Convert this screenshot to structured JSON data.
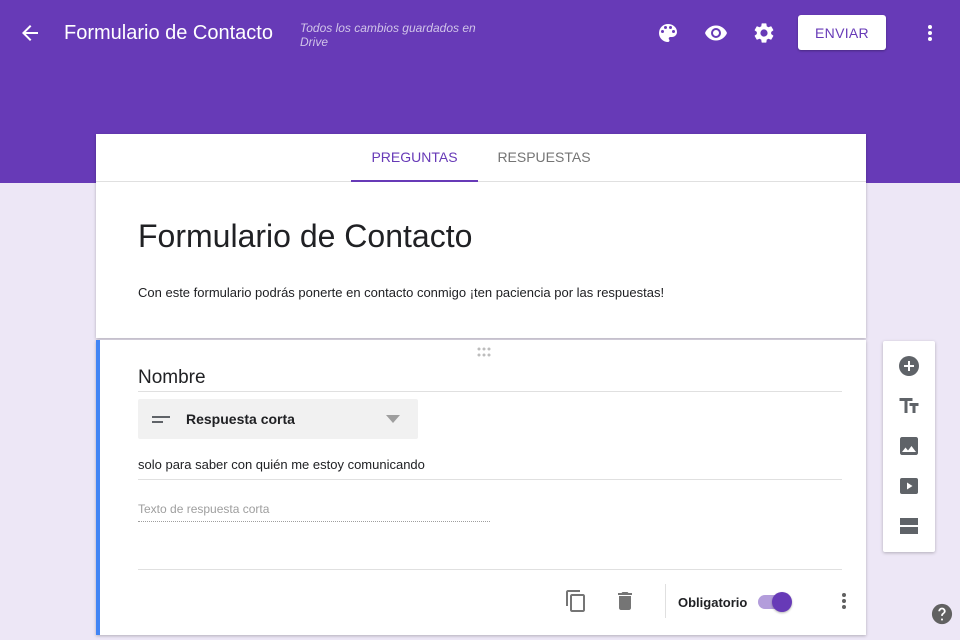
{
  "header": {
    "title": "Formulario de Contacto",
    "save_status": "Todos los cambios guardados en Drive",
    "send_label": "ENVIAR",
    "icons": [
      "back-arrow-icon",
      "palette-icon",
      "eye-icon",
      "gear-icon",
      "more-vert-icon"
    ]
  },
  "tabs": [
    {
      "label": "PREGUNTAS",
      "active": true
    },
    {
      "label": "RESPUESTAS",
      "active": false
    }
  ],
  "form": {
    "title": "Formulario de Contacto",
    "description": "Con este formulario podrás ponerte en contacto conmigo ¡ten paciencia por las respuestas!"
  },
  "question": {
    "title": "Nombre",
    "type_label": "Respuesta corta",
    "description": "solo para saber con quién me estoy comunicando",
    "answer_placeholder": "Texto de respuesta corta",
    "required_label": "Obligatorio",
    "required": true
  },
  "side_toolbar": [
    "add-question-icon",
    "add-title-icon",
    "add-image-icon",
    "add-video-icon",
    "add-section-icon"
  ],
  "colors": {
    "brand": "#673ab7",
    "background": "#ede7f6",
    "active_border": "#4285f4"
  }
}
